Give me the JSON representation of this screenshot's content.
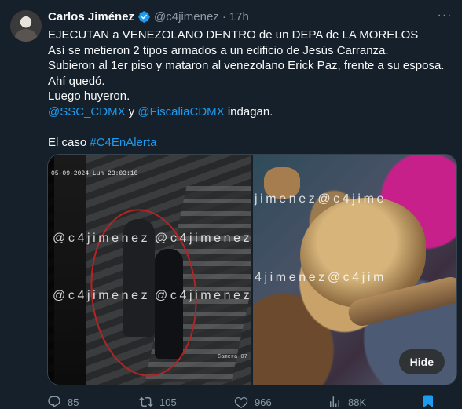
{
  "tweet": {
    "author_name": "Carlos Jiménez",
    "handle": "@c4jimenez",
    "separator": "·",
    "time": "17h",
    "more_label": "···",
    "lines": [
      "EJECUTAN a VENEZOLANO DENTRO de un DEPA de LA MORELOS",
      "Así se metieron 2 tipos armados a un edificio de Jesús Carranza.",
      "Subieron al 1er piso y mataron al venezolano Erick Paz, frente a su esposa.",
      "Ahí quedó.",
      "Luego huyeron."
    ],
    "mention_1": "@SSC_CDMX",
    "connector": " y ",
    "mention_2": "@FiscaliaCDMX",
    "mention_suffix": " indagan.",
    "case_prefix": "El caso ",
    "hashtag": "#C4EnAlerta"
  },
  "media": {
    "left_timestamp": "05-09-2024 Lun 23:03:10",
    "left_camera_label": "Camera 07",
    "watermark": "@c4jimenez",
    "right_watermark_1": "jimenez@c4jime",
    "right_watermark_2": "4jimenez@c4jim",
    "hide_label": "Hide"
  },
  "actions": {
    "replies": "85",
    "reposts": "105",
    "likes": "966",
    "views": "88K"
  },
  "colors": {
    "background": "#15202b",
    "accent": "#1d9bf0",
    "muted": "#8b98a5",
    "verified": "#1d9bf0",
    "circle_annotation": "#d21c1c"
  },
  "icons": {
    "verified": "verified-badge-icon",
    "reply": "reply-icon",
    "repost": "repost-icon",
    "like": "heart-icon",
    "views": "views-chart-icon",
    "bookmark": "bookmark-icon"
  }
}
